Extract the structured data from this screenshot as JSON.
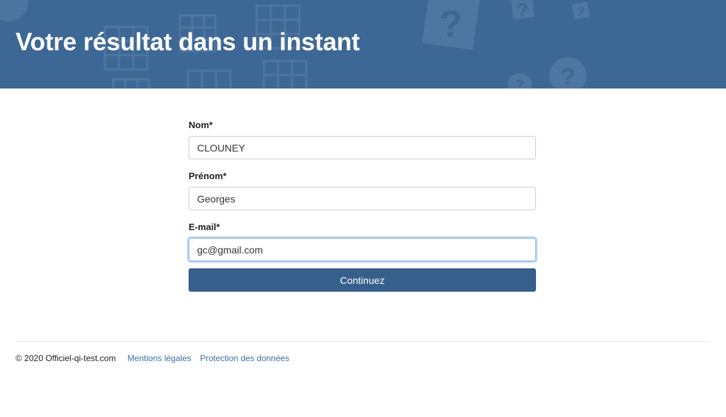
{
  "header": {
    "title": "Votre résultat dans un instant",
    "background_color": "#3d6895"
  },
  "form": {
    "fields": [
      {
        "label": "Nom*",
        "value": "CLOUNEY"
      },
      {
        "label": "Prénom*",
        "value": "Georges"
      },
      {
        "label": "E-mail*",
        "value": "gc@gmail.com",
        "focused": true
      }
    ],
    "submit_label": "Continuez",
    "submit_color": "#365f8c"
  },
  "footer": {
    "copyright": "© 2020 Officiel-qi-test.com",
    "links": [
      "Mentions légales",
      "Protection des données"
    ],
    "link_color": "#3b6ea8"
  },
  "icons": [
    "question-mark-icon",
    "grid-puzzle-icon"
  ]
}
